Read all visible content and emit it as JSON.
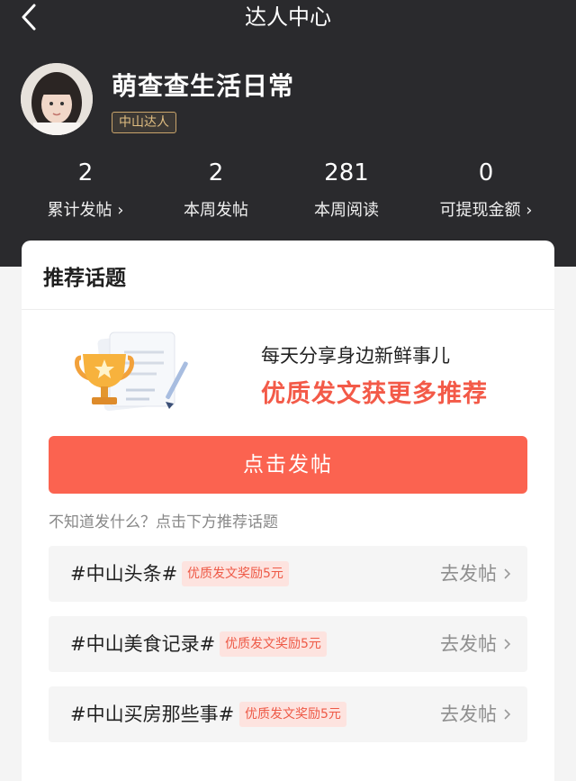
{
  "nav": {
    "title": "达人中心",
    "back_icon": "chevron-left-icon"
  },
  "profile": {
    "name": "萌查查生活日常",
    "badge": "中山达人",
    "avatar_icon": "user-avatar"
  },
  "stats": [
    {
      "value": "2",
      "label": "累计发帖 ›"
    },
    {
      "value": "2",
      "label": "本周发帖"
    },
    {
      "value": "281",
      "label": "本周阅读"
    },
    {
      "value": "0",
      "label": "可提现金额 ›"
    }
  ],
  "topics_card": {
    "title": "推荐话题",
    "promo_line1": "每天分享身边新鲜事儿",
    "promo_line2": "优质发文获更多推荐",
    "post_button": "点击发帖",
    "hint": "不知道发什么？点击下方推荐话题",
    "topics": [
      {
        "name": "#中山头条#",
        "tag": "优质发文奖励5元",
        "action": "去发帖"
      },
      {
        "name": "#中山美食记录#",
        "tag": "优质发文奖励5元",
        "action": "去发帖"
      },
      {
        "name": "#中山买房那些事#",
        "tag": "优质发文奖励5元",
        "action": "去发帖"
      }
    ]
  },
  "colors": {
    "header_bg": "#2a2a2d",
    "accent": "#fb6350",
    "badge_gold": "#c9a46b"
  }
}
